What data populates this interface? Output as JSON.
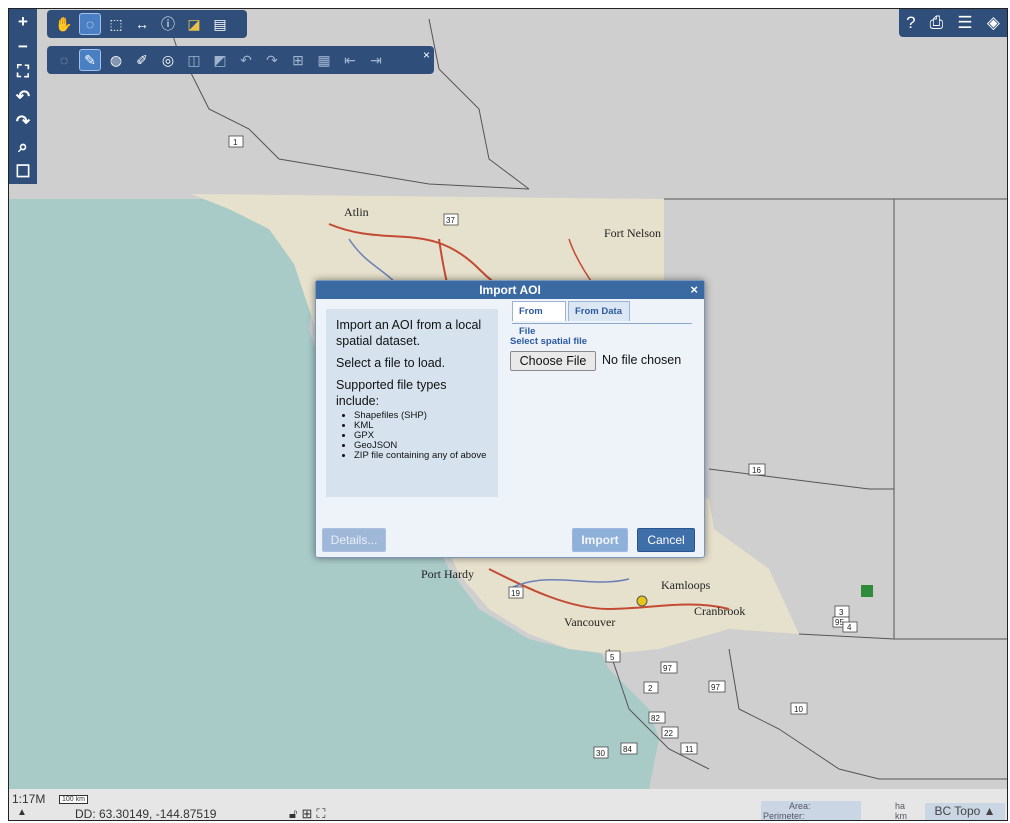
{
  "colors": {
    "toolbar": "#2f4f7a",
    "dialog_title": "#3b6aa3",
    "ocean": "#a9cbc8",
    "land_outside": "#cfcfcf"
  },
  "map": {
    "places": [
      "Atlin",
      "Fort Nelson",
      "Port Hardy",
      "Kamloops",
      "Cranbrook",
      "Vancouver"
    ],
    "highways": [
      "1",
      "37",
      "16",
      "19",
      "5",
      "97",
      "2",
      "97",
      "82",
      "22",
      "30",
      "84",
      "11",
      "10",
      "3",
      "95",
      "4"
    ]
  },
  "left_toolbar": {
    "icons": [
      "zoom-in-icon",
      "zoom-out-icon",
      "zoom-extent-icon",
      "previous-extent-icon",
      "next-extent-icon",
      "search-icon",
      "bookmark-icon"
    ],
    "glyphs": [
      "+",
      "−",
      "⛶",
      "↶",
      "↷",
      "⌕",
      "☐"
    ]
  },
  "top_toolbar": {
    "glyphs": [
      "✋",
      "◌",
      "⬚",
      "↔",
      "ⓘ",
      "◪",
      "▤"
    ]
  },
  "edit_toolbar": {
    "glyphs": [
      "◌",
      "✎",
      "◍",
      "✐",
      "◎",
      "◫",
      "◩",
      "↶",
      "↷",
      "⊞",
      "▦",
      "⇤",
      "⇥"
    ],
    "close": "×"
  },
  "right_toolbar": {
    "glyphs": [
      "?",
      "⎙",
      "☰",
      "◈"
    ]
  },
  "dialog": {
    "title": "Import AOI",
    "close": "×",
    "tabs": [
      "From File",
      "From Data"
    ],
    "info": {
      "line1": "Import an AOI from a local spatial dataset.",
      "line2": "Select a file to load.",
      "line3": "Supported file types include:",
      "types": [
        "Shapefiles (SHP)",
        "KML",
        "GPX",
        "GeoJSON",
        "ZIP file containing any of above"
      ]
    },
    "select_label": "Select spatial file",
    "choose_button": "Choose File",
    "no_file": "No file chosen",
    "details_button": "Details...",
    "import_button": "Import",
    "cancel_button": "Cancel"
  },
  "status_bar": {
    "scale": "1:17M",
    "scale_bar": "100 km",
    "coords": "DD: 63.30149, -144.87519",
    "area_label": "Area:",
    "perimeter_label": "Perimeter:",
    "area_unit": "ha",
    "perimeter_unit": "km",
    "basemap": "BC Topo ▲",
    "expand": "▲"
  }
}
